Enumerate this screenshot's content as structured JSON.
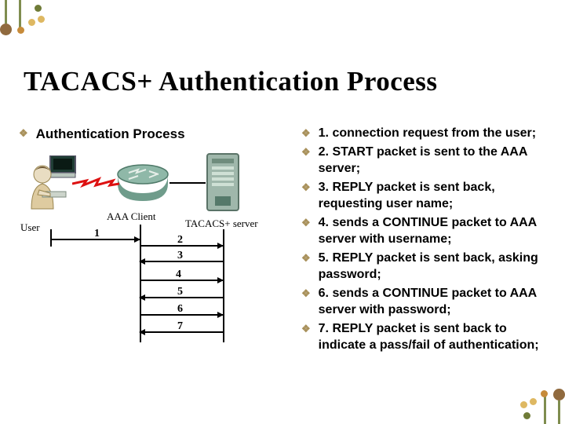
{
  "title": "TACACS+ Authentication Process",
  "left": {
    "heading": "Authentication Process",
    "diagram": {
      "user_label": "User",
      "aaa_label": "AAA Client",
      "server_label": "TACACS+ server",
      "steps": [
        "1",
        "2",
        "3",
        "4",
        "5",
        "6",
        "7"
      ]
    }
  },
  "steps": [
    "1. connection request from the user;",
    "2. START packet is sent to the AAA server;",
    "3. REPLY packet is sent back, requesting user name;",
    "4. sends a CONTINUE packet to AAA server with username;",
    "5. REPLY packet is sent back, asking password;",
    "6. sends a CONTINUE packet to AAA server with password;",
    "7. REPLY packet is sent back to indicate a pass/fail of authentication;"
  ],
  "bullet_glyph": "❖"
}
